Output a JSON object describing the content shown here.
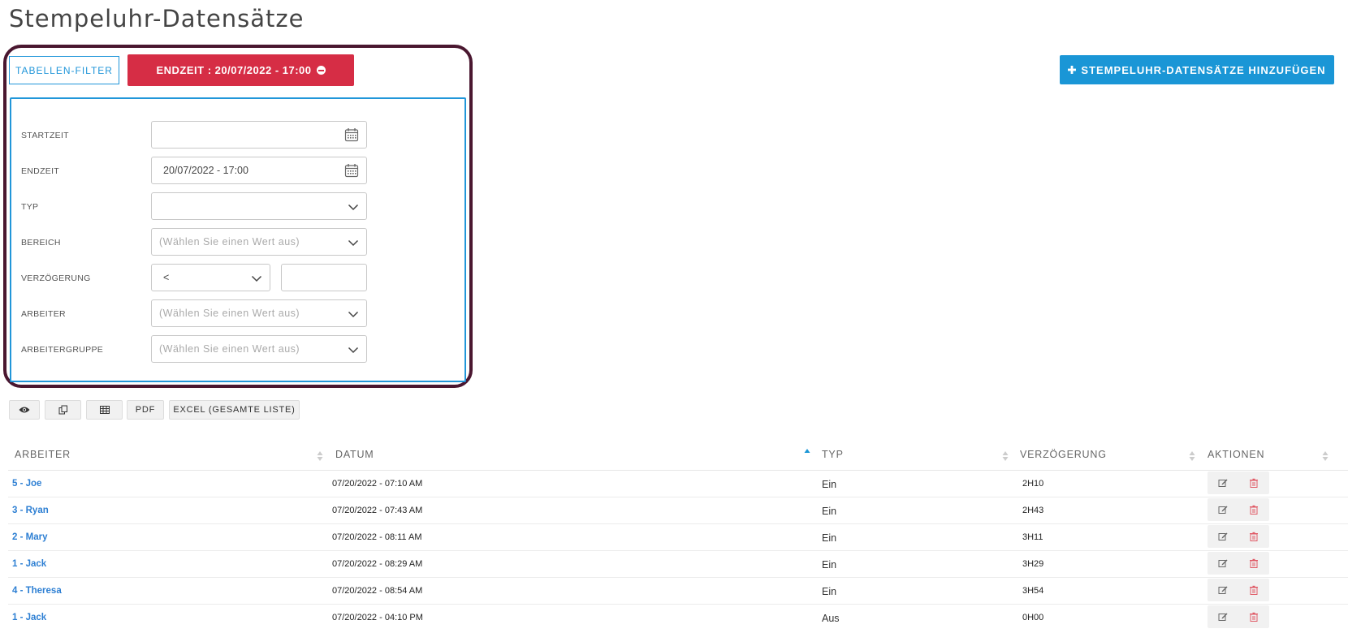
{
  "page": {
    "title": "Stempeluhr-Datensätze"
  },
  "filter_bar": {
    "toggle_label": "TABELLEN-FILTER",
    "active_filter_label": "ENDZEIT : 20/07/2022 - 17:00",
    "add_button_label": "STEMPELUHR-DATENSÄTZE HINZUFÜGEN",
    "accent_color": "#1a96d6",
    "chip_color": "#d62d45"
  },
  "filters": {
    "start_label": "STARTZEIT",
    "start_value": "",
    "end_label": "ENDZEIT",
    "end_value": "20/07/2022 - 17:00",
    "type_label": "TYP",
    "type_value": "",
    "area_label": "BEREICH",
    "area_placeholder": "(Wählen Sie einen Wert aus)",
    "delay_label": "VERZÖGERUNG",
    "delay_operator": "<",
    "delay_value": "",
    "worker_label": "ARBEITER",
    "worker_placeholder": "(Wählen Sie einen Wert aus)",
    "group_label": "ARBEITERGRUPPE",
    "group_placeholder": "(Wählen Sie einen Wert aus)"
  },
  "toolbar": {
    "pdf_label": "PDF",
    "excel_label": "EXCEL (GESAMTE LISTE)",
    "icons": [
      "eye-icon",
      "copy-icon",
      "table-icon"
    ]
  },
  "table": {
    "columns": [
      "ARBEITER",
      "DATUM",
      "TYP",
      "VERZÖGERUNG",
      "AKTIONEN"
    ],
    "sorted_column": "DATUM",
    "rows": [
      {
        "worker": "5 - Joe",
        "date": "07/20/2022 - 07:10 AM",
        "type": "Ein",
        "delay": "2H10"
      },
      {
        "worker": "3 - Ryan",
        "date": "07/20/2022 - 07:43 AM",
        "type": "Ein",
        "delay": "2H43"
      },
      {
        "worker": "2 - Mary",
        "date": "07/20/2022 - 08:11 AM",
        "type": "Ein",
        "delay": "3H11"
      },
      {
        "worker": "1 - Jack",
        "date": "07/20/2022 - 08:29 AM",
        "type": "Ein",
        "delay": "3H29"
      },
      {
        "worker": "4 - Theresa",
        "date": "07/20/2022 - 08:54 AM",
        "type": "Ein",
        "delay": "3H54"
      },
      {
        "worker": "1 - Jack",
        "date": "07/20/2022 - 04:10 PM",
        "type": "Aus",
        "delay": "0H00"
      }
    ]
  }
}
